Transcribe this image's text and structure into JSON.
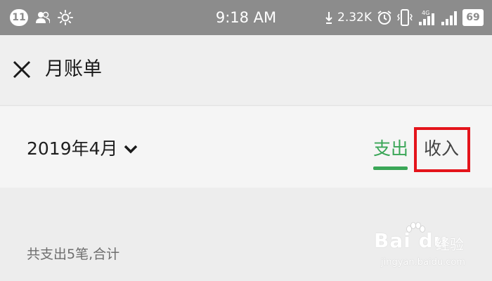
{
  "status_bar": {
    "notification_count": "11",
    "time": "9:18 AM",
    "net_speed": "2.32K",
    "network": "4G",
    "battery": "69"
  },
  "header": {
    "title": "月账单"
  },
  "month_bar": {
    "month": "2019年4月",
    "tabs": [
      {
        "label": "支出",
        "selected": true
      },
      {
        "label": "收入",
        "selected": false
      }
    ]
  },
  "summary": {
    "text": "共支出5笔,合计"
  },
  "watermark": {
    "brand": "Bai du",
    "label": "经验",
    "url": "jingyan.baidu.com"
  },
  "colors": {
    "accent_green": "#3aa657",
    "highlight_red": "#e4141b",
    "status_bar_bg": "#8c8c8c"
  }
}
